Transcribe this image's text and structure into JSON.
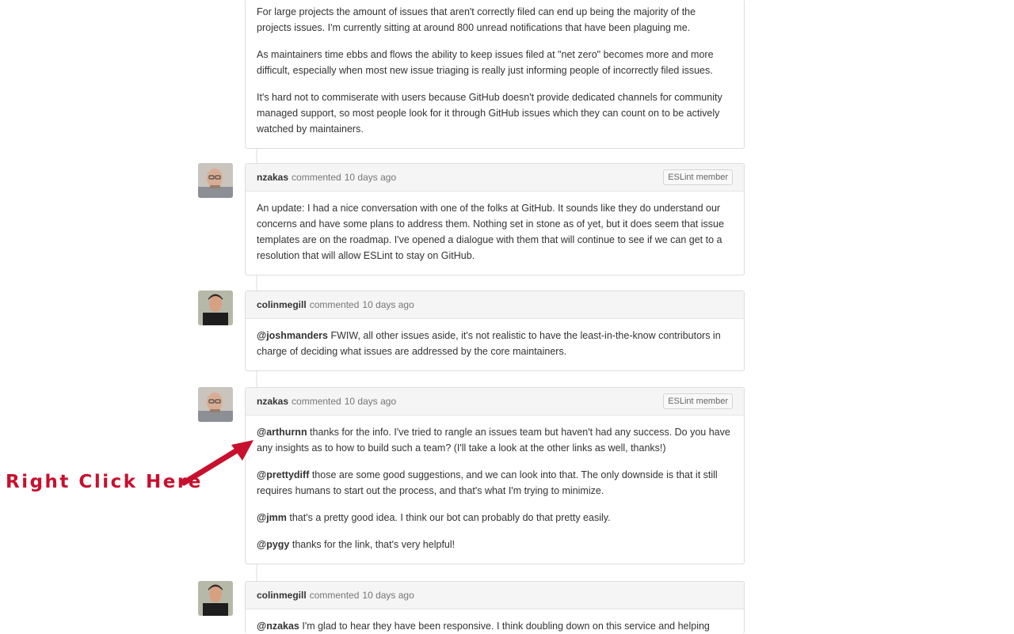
{
  "comments": [
    {
      "author": "",
      "action": "",
      "time": "",
      "badge": "",
      "paragraphs": [
        {
          "mention": "",
          "text": "For large projects the amount of issues that aren't correctly filed can end up being the majority of the projects issues. I'm currently sitting at around 800 unread notifications that have been plaguing me."
        },
        {
          "mention": "",
          "text": "As maintainers time ebbs and flows the ability to keep issues filed at \"net zero\" becomes more and more difficult, especially when most new issue triaging is really just informing people of incorrectly filed issues."
        },
        {
          "mention": "",
          "text": "It's hard not to commiserate with users because GitHub doesn't provide dedicated channels for community managed support, so most people look for it through GitHub issues which they can count on to be actively watched by maintainers."
        }
      ]
    },
    {
      "author": "nzakas",
      "action": "commented",
      "time": "10 days ago",
      "badge": "ESLint member",
      "paragraphs": [
        {
          "mention": "",
          "text": "An update: I had a nice conversation with one of the folks at GitHub. It sounds like they do understand our concerns and have some plans to address them. Nothing set in stone as of yet, but it does seem that issue templates are on the roadmap. I've opened a dialogue with them that will continue to see if we can get to a resolution that will allow ESLint to stay on GitHub."
        }
      ]
    },
    {
      "author": "colinmegill",
      "action": "commented",
      "time": "10 days ago",
      "badge": "",
      "paragraphs": [
        {
          "mention": "@joshmanders",
          "text": " FWIW, all other issues aside, it's not realistic to have the least-in-the-know contributors in charge of deciding what issues are addressed by the core maintainers."
        }
      ]
    },
    {
      "author": "nzakas",
      "action": "commented",
      "time": "10 days ago",
      "badge": "ESLint member",
      "paragraphs": [
        {
          "mention": "@arthurnn",
          "text": " thanks for the info. I've tried to rangle an issues team but haven't had any success. Do you have any insights as to how to build such a team? (I'll take a look at the other links as well, thanks!)"
        },
        {
          "mention": "@prettydiff",
          "text": " those are some good suggestions, and we can look into that. The only downside is that it still requires humans to start out the process, and that's what I'm trying to minimize."
        },
        {
          "mention": "@jmm",
          "text": " that's a pretty good idea. I think our bot can probably do that pretty easily."
        },
        {
          "mention": "@pygy",
          "text": " thanks for the link, that's very helpful!"
        }
      ]
    },
    {
      "author": "colinmegill",
      "action": "commented",
      "time": "10 days ago",
      "badge": "",
      "paragraphs": [
        {
          "mention": "@nzakas",
          "text": " I'm glad to hear they have been responsive. I think doubling down on this service and helping"
        }
      ]
    }
  ],
  "annotation": {
    "label": "Right Click Here",
    "color": "#c8102e"
  }
}
